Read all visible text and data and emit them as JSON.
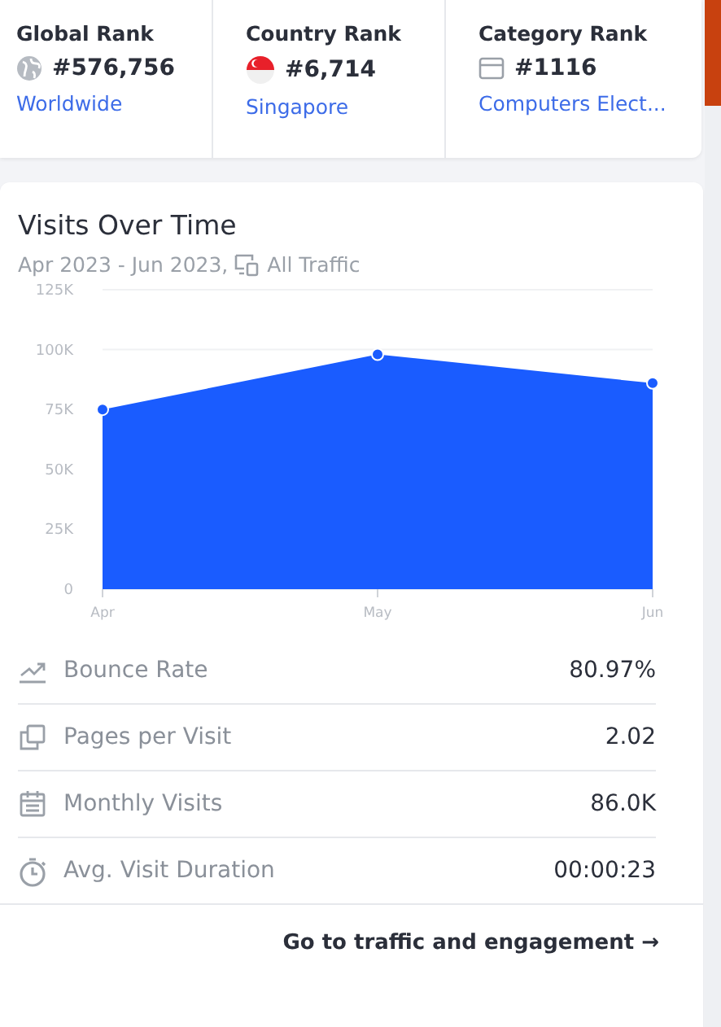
{
  "ranks": [
    {
      "kind": "globe",
      "title": "Global Rank",
      "value": "#576,756",
      "link": "Worldwide"
    },
    {
      "kind": "flag",
      "title": "Country Rank",
      "value": "#6,714",
      "link": "Singapore"
    },
    {
      "kind": "category",
      "title": "Category Rank",
      "value": "#1116",
      "link": "Computers Elect..."
    }
  ],
  "visits": {
    "title": "Visits Over Time",
    "period": "Apr 2023 - Jun 2023,",
    "traffic": "All Traffic",
    "chart_data": {
      "type": "area",
      "categories": [
        "Apr",
        "May",
        "Jun"
      ],
      "series": [
        {
          "color": "#1a5cff",
          "values": [
            75000,
            98000,
            86000
          ]
        }
      ],
      "ylim": [
        0,
        125000
      ],
      "yticks": [
        {
          "value": 0,
          "label": "0"
        },
        {
          "value": 25000,
          "label": "25K"
        },
        {
          "value": 50000,
          "label": "50K"
        },
        {
          "value": 75000,
          "label": "75K"
        },
        {
          "value": 100000,
          "label": "100K"
        },
        {
          "value": 125000,
          "label": "125K"
        }
      ]
    }
  },
  "metrics": [
    {
      "kind": "bounce",
      "label": "Bounce Rate",
      "value": "80.97%"
    },
    {
      "kind": "pages",
      "label": "Pages per Visit",
      "value": "2.02"
    },
    {
      "kind": "monthly",
      "label": "Monthly Visits",
      "value": "86.0K"
    },
    {
      "kind": "duration",
      "label": "Avg. Visit Duration",
      "value": "00:00:23"
    }
  ],
  "footer_link": "Go to traffic and engagement →"
}
